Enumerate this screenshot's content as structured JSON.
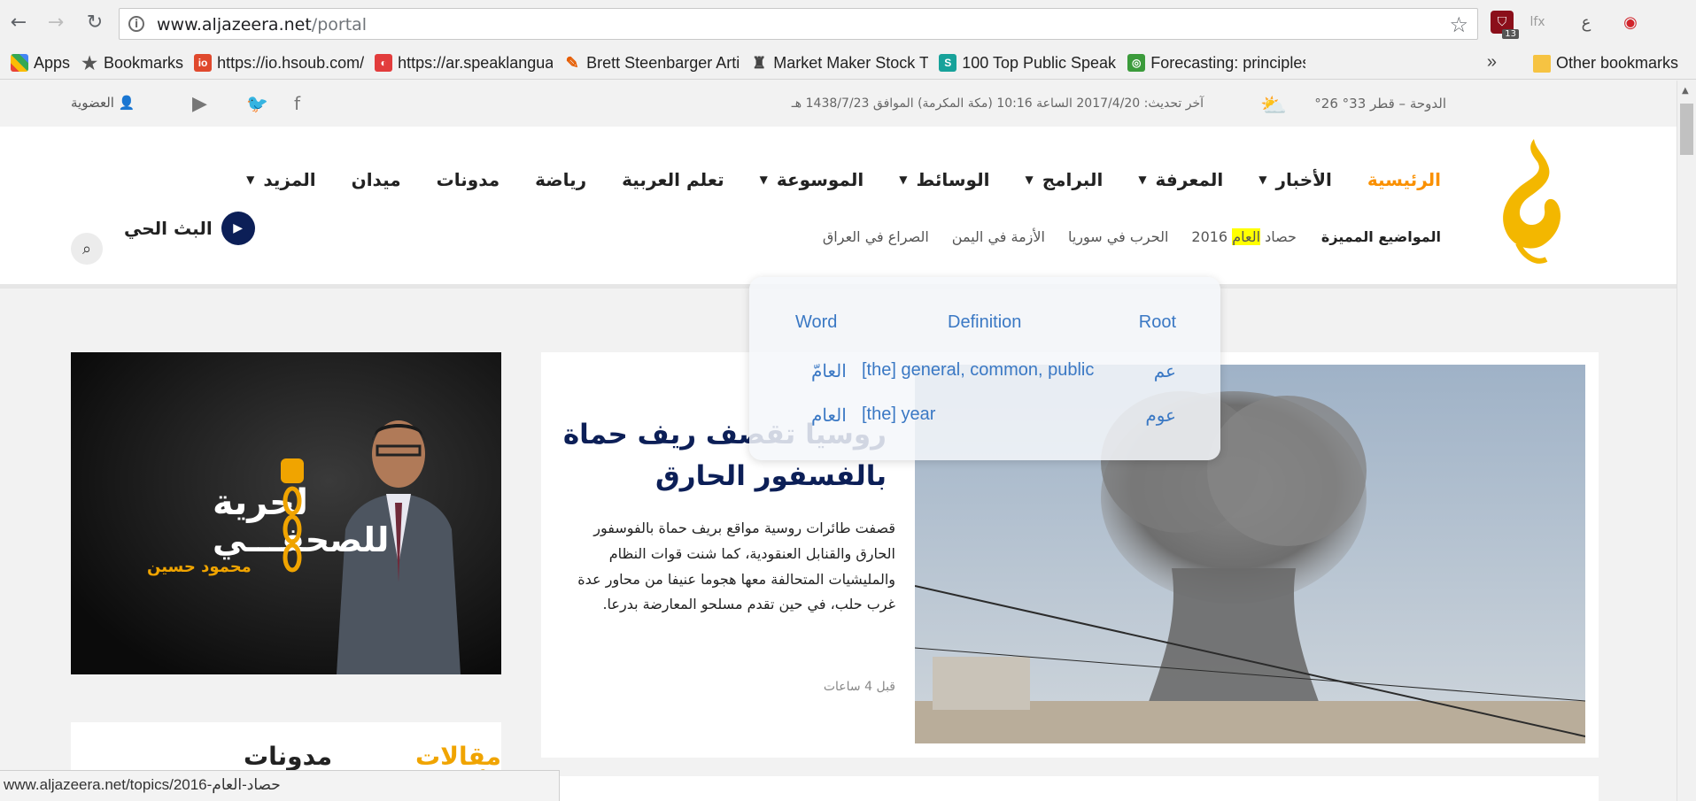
{
  "browser": {
    "url_domain": "www.aljazeera.net",
    "url_path": "/portal",
    "extension_badge": "13",
    "bookmarks": [
      {
        "label": "Apps",
        "icon": "apps-grid-icon"
      },
      {
        "label": "Bookmarks",
        "icon": "star-icon"
      },
      {
        "label": "https://io.hsoub.com/",
        "icon": "hsoub-icon"
      },
      {
        "label": "https://ar.speaklangua",
        "icon": "speaklanguage-icon"
      },
      {
        "label": "Brett Steenbarger Arti",
        "icon": "feather-icon"
      },
      {
        "label": "Market Maker Stock T",
        "icon": "chess-icon"
      },
      {
        "label": "100 Top Public Speaki",
        "icon": "s-icon"
      },
      {
        "label": "Forecasting: principles",
        "icon": "forecast-icon"
      }
    ],
    "other_bookmarks": "Other bookmarks",
    "status_url": "www.aljazeera.net/topics/2016-حصاد-العام"
  },
  "topbar": {
    "location": "الدوحة – قطر 33° 26°",
    "updated": "آخر تحديث: 2017/4/20 الساعة 10:16 (مكة المكرمة) الموافق 1438/7/23 هـ",
    "membership": "العضوية"
  },
  "nav": {
    "items": [
      {
        "label": "الرئيسية",
        "active": true,
        "dropdown": false
      },
      {
        "label": "الأخبار",
        "dropdown": true
      },
      {
        "label": "المعرفة",
        "dropdown": true
      },
      {
        "label": "البرامج",
        "dropdown": true
      },
      {
        "label": "الوسائط",
        "dropdown": true
      },
      {
        "label": "الموسوعة",
        "dropdown": true
      },
      {
        "label": "تعلم العربية",
        "dropdown": false
      },
      {
        "label": "رياضة",
        "dropdown": false
      },
      {
        "label": "مدونات",
        "dropdown": false
      },
      {
        "label": "ميدان",
        "dropdown": false
      },
      {
        "label": "المزيد",
        "dropdown": true
      }
    ],
    "featured_title": "المواضيع المميزة",
    "topics": {
      "t1_pre": "حصاد ",
      "t1_hl": "العام",
      "t1_post": " 2016",
      "t2": "الحرب في سوريا",
      "t3": "الأزمة في اليمن",
      "t4": "الصراع في العراق"
    },
    "live": "البث الحي"
  },
  "promo": {
    "title_line1": "لحرية",
    "title_line2": "للصحفـــي",
    "name": "محمود حسين"
  },
  "featured": {
    "headline": "روسيا تقصف ريف حماة بالفسفور الحارق",
    "summary": "قصفت طائرات روسية مواقع بريف حماة بالفوسفور الحارق والقنابل العنقودية، كما شنت قوات النظام والمليشيات المتحالفة معها هجوما عنيفا من محاور عدة غرب حلب، في حين تقدم مسلحو المعارضة بدرعا.",
    "time": "قبل 4 ساعات"
  },
  "opinions": {
    "tab_opinion": "مقالات رأي",
    "tab_blogs": "مدونات"
  },
  "dictionary": {
    "headers": {
      "word": "Word",
      "definition": "Definition",
      "root": "Root"
    },
    "rows": [
      {
        "word": "العامّ",
        "definition": "[the] general, common, public",
        "root": "عم"
      },
      {
        "word": "العام",
        "definition": "[the] year",
        "root": "عوم"
      }
    ]
  },
  "colors": {
    "accent": "#fa9000",
    "navy": "#0c1f57",
    "dict_text": "#3a78c4"
  }
}
